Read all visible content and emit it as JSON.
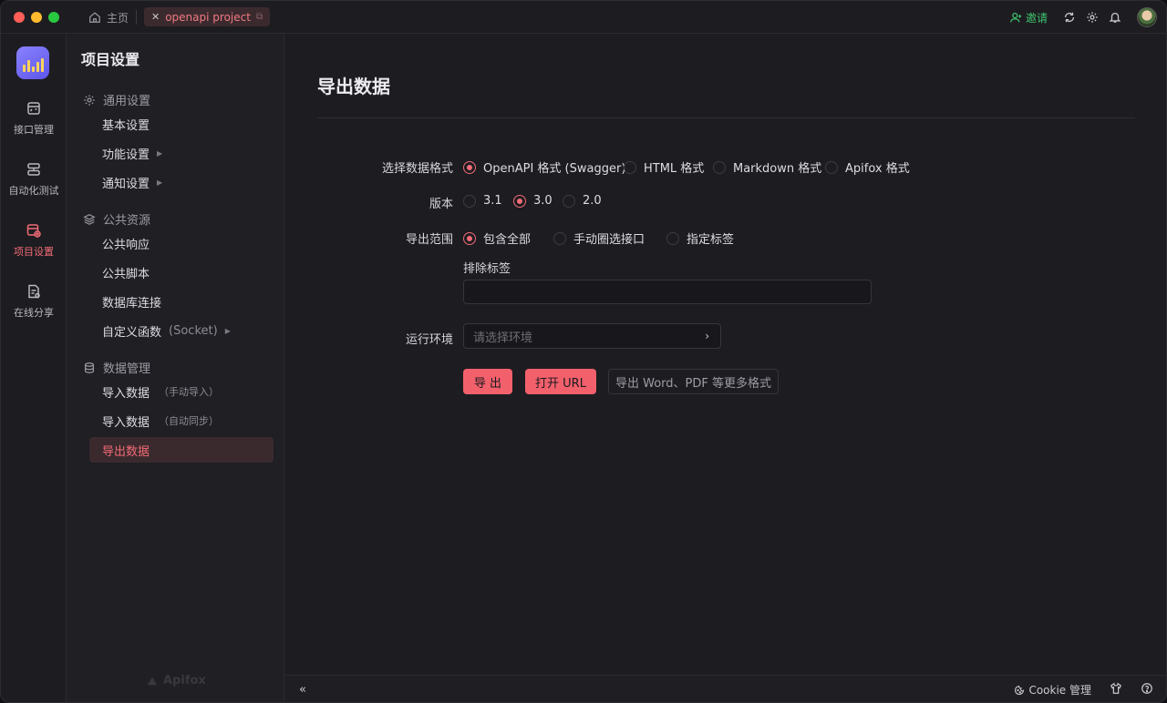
{
  "titlebar": {
    "home_tab": "主页",
    "project_tab": "openapi project",
    "invite": "邀请"
  },
  "rail": {
    "items": [
      {
        "label": "接口管理"
      },
      {
        "label": "自动化测试"
      },
      {
        "label": "项目设置"
      },
      {
        "label": "在线分享"
      }
    ]
  },
  "nav": {
    "title": "项目设置",
    "groups": [
      {
        "label": "通用设置"
      },
      {
        "label": "公共资源"
      },
      {
        "label": "数据管理"
      }
    ],
    "items": {
      "basic": "基本设置",
      "feature": "功能设置",
      "notify": "通知设置",
      "public_response": "公共响应",
      "public_script": "公共脚本",
      "db_conn": "数据库连接",
      "custom_func": "自定义函数",
      "custom_func_paren": "(Socket)",
      "import_manual": "导入数据",
      "import_manual_sub": "（手动导入）",
      "import_auto": "导入数据",
      "import_auto_sub": "（自动同步）",
      "export": "导出数据"
    },
    "brand": "Apifox"
  },
  "main": {
    "title": "导出数据",
    "format_label": "选择数据格式",
    "formats": [
      "OpenAPI 格式 (Swagger)",
      "HTML 格式",
      "Markdown 格式",
      "Apifox 格式"
    ],
    "version_label": "版本",
    "versions": [
      "3.1",
      "3.0",
      "2.0"
    ],
    "scope_label": "导出范围",
    "scopes": [
      "包含全部",
      "手动圈选接口",
      "指定标签"
    ],
    "exclude_tags_label": "排除标签",
    "exclude_tags_value": "",
    "env_label": "运行环境",
    "env_placeholder": "请选择环境",
    "buttons": {
      "export": "导 出",
      "open_url": "打开 URL",
      "more_formats": "导出 Word、PDF 等更多格式"
    }
  },
  "statusbar": {
    "cookie": "Cookie 管理"
  },
  "colors": {
    "accent": "#f26b76",
    "primary_button": "#f2606c",
    "invite": "#3ec46d",
    "background": "#1c1c21"
  },
  "selected": {
    "format": "OpenAPI 格式 (Swagger)",
    "version": "3.0",
    "scope": "包含全部"
  }
}
